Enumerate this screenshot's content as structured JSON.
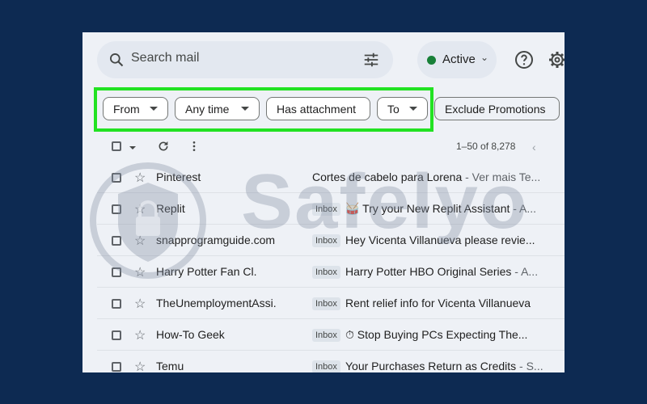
{
  "search": {
    "placeholder": "Search mail"
  },
  "status": {
    "label": "Active",
    "color": "#188038"
  },
  "filters": {
    "from": "From",
    "any_time": "Any time",
    "has_attachment": "Has attachment",
    "to": "To",
    "exclude_promotions": "Exclude Promotions"
  },
  "toolbar": {
    "range": "1–50 of 8,278",
    "prev_glyph": "‹"
  },
  "emails": [
    {
      "sender": "Pinterest",
      "label": "",
      "subject": "Cortes de cabelo para Lorena",
      "snippet": " - Ver mais Te..."
    },
    {
      "sender": "Replit",
      "label": "Inbox",
      "subject": "🥁 Try your New Replit Assistant",
      "snippet": " - A..."
    },
    {
      "sender": "snapprogramguide.com",
      "label": "Inbox",
      "subject": "Hey Vicenta Villanueva please revie...",
      "snippet": ""
    },
    {
      "sender": "Harry Potter Fan Cl.",
      "label": "Inbox",
      "subject": "Harry Potter HBO Original Series",
      "snippet": " - A..."
    },
    {
      "sender": "TheUnemploymentAssi.",
      "label": "Inbox",
      "subject": "Rent relief info for Vicenta Villanueva",
      "snippet": ""
    },
    {
      "sender": "How-To Geek",
      "label": "Inbox",
      "subject": "⏱ Stop Buying PCs Expecting The...",
      "snippet": ""
    },
    {
      "sender": "Temu",
      "label": "Inbox",
      "subject": "Your Purchases Return as Credits",
      "snippet": " - S..."
    }
  ],
  "watermark": {
    "text": "Safelyo"
  },
  "colors": {
    "highlight": "#22e222",
    "background": "#0d2a52"
  }
}
